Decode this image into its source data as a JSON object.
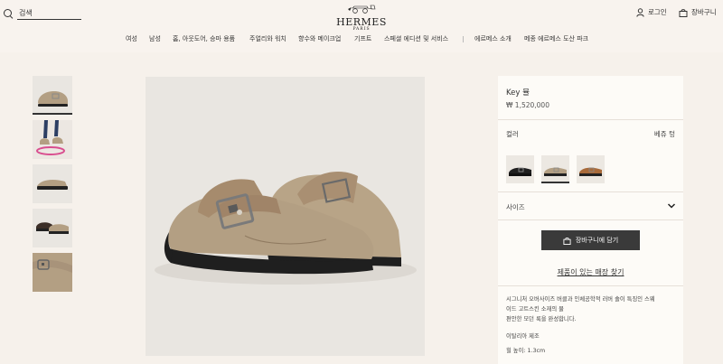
{
  "header": {
    "search_placeholder": "검색",
    "brand": "HERMES",
    "brand_city": "PARIS",
    "login_label": "로그인",
    "cart_label": "장바구니"
  },
  "nav": {
    "items": [
      "여성",
      "남성",
      "홈, 아웃도어, 승마 용품",
      "주얼리와 워치",
      "향수와 메이크업",
      "기프트",
      "스페셜 에디션 및 서비스",
      "에르메스 소개",
      "메종 에르메스 도산 파크"
    ]
  },
  "product": {
    "name": "Key 뮬",
    "price": "₩ 1,520,000",
    "color_label": "컬러",
    "color_value": "베쥬 텅",
    "size_label": "사이즈",
    "add_to_cart": "장바구니에 담기",
    "find_in_store": "제품이 있는 매장 찾기",
    "description_lines": [
      "시그니처 오버사이즈 버클과 인체공학적 러버 솔이 특징인 스웨",
      "이드 고트스킨 소재의 뮬",
      "편안한 모던 룩을 완성합니다."
    ],
    "made_in": "이탈리아 제조",
    "heel": "힐 높이: 1.3cm",
    "swatches": [
      "black",
      "beige",
      "tan"
    ]
  },
  "colors": {
    "page_bg": "#f6f1eb",
    "panel_bg": "#fdfbf7",
    "button_bg": "#3a3a3a",
    "suede_beige": "#b39f83",
    "sole_black": "#1f1f1f"
  }
}
